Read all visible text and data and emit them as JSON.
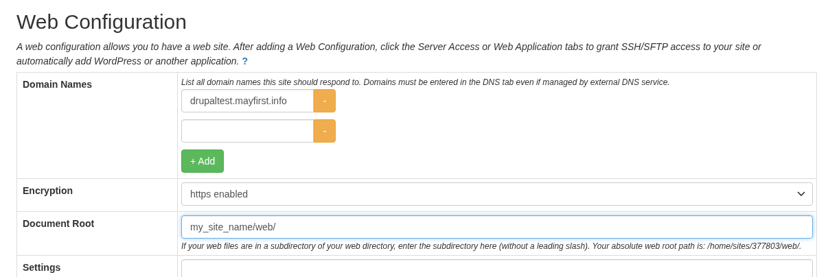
{
  "title": "Web Configuration",
  "description": "*A web configuration allows you to have a web site. After adding a Web Configuration, click the Server Access or Web Application tabs to grant SSH/SFTP access to your site or automatically add WordPress or another application.*",
  "help_link": "?",
  "rows": [
    {
      "kind": "domains",
      "label": "Domain Names",
      "help": "List all domain names this site should respond to. Domains must be entered in the DNS tab even if managed by external DNS service.",
      "domains": [
        {
          "value": "drupaltest.mayfirst.info",
          "remove": "-"
        },
        {
          "remove": "-"
        }
      ],
      "add": "+ Add"
    },
    {
      "kind": "select",
      "label": "Encryption",
      "value": "https enabled"
    },
    {
      "kind": "text",
      "label": "Document Root",
      "value": "my_site_name/web/",
      "focused": true,
      "help": "If your web files are in a subdirectory of your web directory, enter the subdirectory here (without a leading slash). Your absolute web root path is: /home/sites/377803/web/."
    },
    {
      "kind": "text",
      "label": "Settings",
      "focused": false
    }
  ]
}
